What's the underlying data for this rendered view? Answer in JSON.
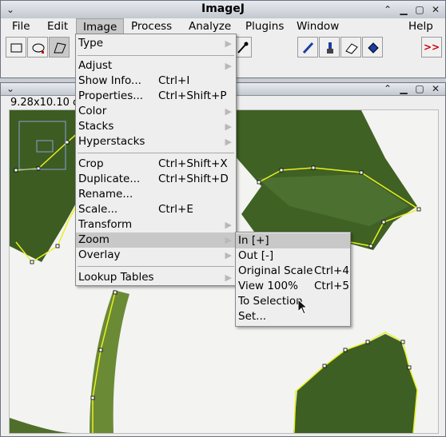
{
  "app": {
    "title": "ImageJ"
  },
  "menubar": [
    "File",
    "Edit",
    "Image",
    "Process",
    "Analyze",
    "Plugins",
    "Window",
    "Help"
  ],
  "toolbar": {
    "tools": [
      "rectangle-tool",
      "oval-tool",
      "polygon-tool",
      "freehand-tool"
    ],
    "more_label": ">>"
  },
  "image_window": {
    "info": "9.28x10.10 cm"
  },
  "image_menu": {
    "items": [
      {
        "label": "Type",
        "shortcut": "",
        "submenu": true
      },
      {
        "label": "Adjust",
        "shortcut": "",
        "submenu": true
      },
      {
        "label": "Show Info...",
        "shortcut": "Ctrl+I",
        "submenu": false
      },
      {
        "label": "Properties...",
        "shortcut": "Ctrl+Shift+P",
        "submenu": false
      },
      {
        "label": "Color",
        "shortcut": "",
        "submenu": true
      },
      {
        "label": "Stacks",
        "shortcut": "",
        "submenu": true
      },
      {
        "label": "Hyperstacks",
        "shortcut": "",
        "submenu": true
      },
      {
        "label": "Crop",
        "shortcut": "Ctrl+Shift+X",
        "submenu": false
      },
      {
        "label": "Duplicate...",
        "shortcut": "Ctrl+Shift+D",
        "submenu": false
      },
      {
        "label": "Rename...",
        "shortcut": "",
        "submenu": false
      },
      {
        "label": "Scale...",
        "shortcut": "Ctrl+E",
        "submenu": false
      },
      {
        "label": "Transform",
        "shortcut": "",
        "submenu": true
      },
      {
        "label": "Zoom",
        "shortcut": "",
        "submenu": true
      },
      {
        "label": "Overlay",
        "shortcut": "",
        "submenu": true
      },
      {
        "label": "Lookup Tables",
        "shortcut": "",
        "submenu": true
      }
    ]
  },
  "zoom_menu": {
    "items": [
      {
        "label": "In [+]",
        "shortcut": ""
      },
      {
        "label": "Out [-]",
        "shortcut": ""
      },
      {
        "label": "Original Scale",
        "shortcut": "Ctrl+4"
      },
      {
        "label": "View 100%",
        "shortcut": "Ctrl+5"
      },
      {
        "label": "To Selection",
        "shortcut": ""
      },
      {
        "label": "Set...",
        "shortcut": ""
      }
    ]
  },
  "colors": {
    "selection": "#e8f020",
    "leaf": "#3a5a1e",
    "menu_highlight": "#c8c8c8"
  }
}
